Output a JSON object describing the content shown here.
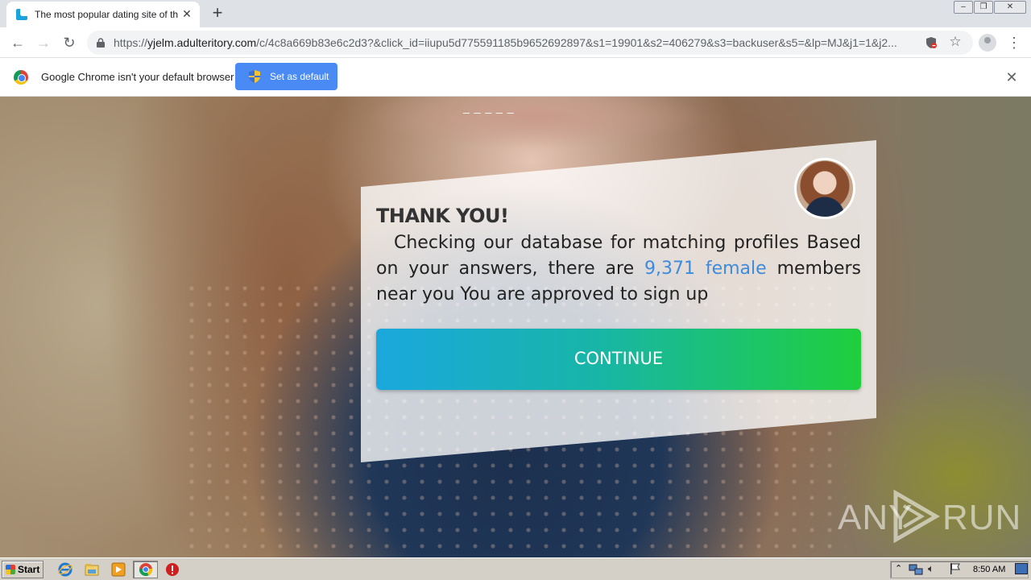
{
  "browser": {
    "tab": {
      "title": "The most popular dating site of this m"
    },
    "url": {
      "host": "yjelm.adulteritory.com",
      "scheme": "https://",
      "path": "/c/4c8a669b83e6c2d3?&click_id=iiupu5d775591185b9652692897&s1=19901&s2=406279&s3=backuser&s5=&lp=MJ&j1=1&j2..."
    },
    "infobar": {
      "message": "Google Chrome isn't your default browser",
      "button_label": "Set as default"
    }
  },
  "page": {
    "dashes": "_ _ _ _ _",
    "card": {
      "title": "THANK YOU!",
      "line_start": "Checking our database for matching profiles Based on your answers, there are ",
      "highlight": "9,371 female",
      "line_end": " members near you You are approved to sign up",
      "continue_label": "CONTINUE"
    },
    "watermark": {
      "left": "ANY",
      "right": "RUN"
    }
  },
  "taskbar": {
    "start_label": "Start",
    "clock": "8:50 AM"
  },
  "colors": {
    "accent": "#4a8af4",
    "highlight": "#3d8bdd",
    "button_gradient_start": "#1aa8dd",
    "button_gradient_end": "#1fcf3d"
  }
}
